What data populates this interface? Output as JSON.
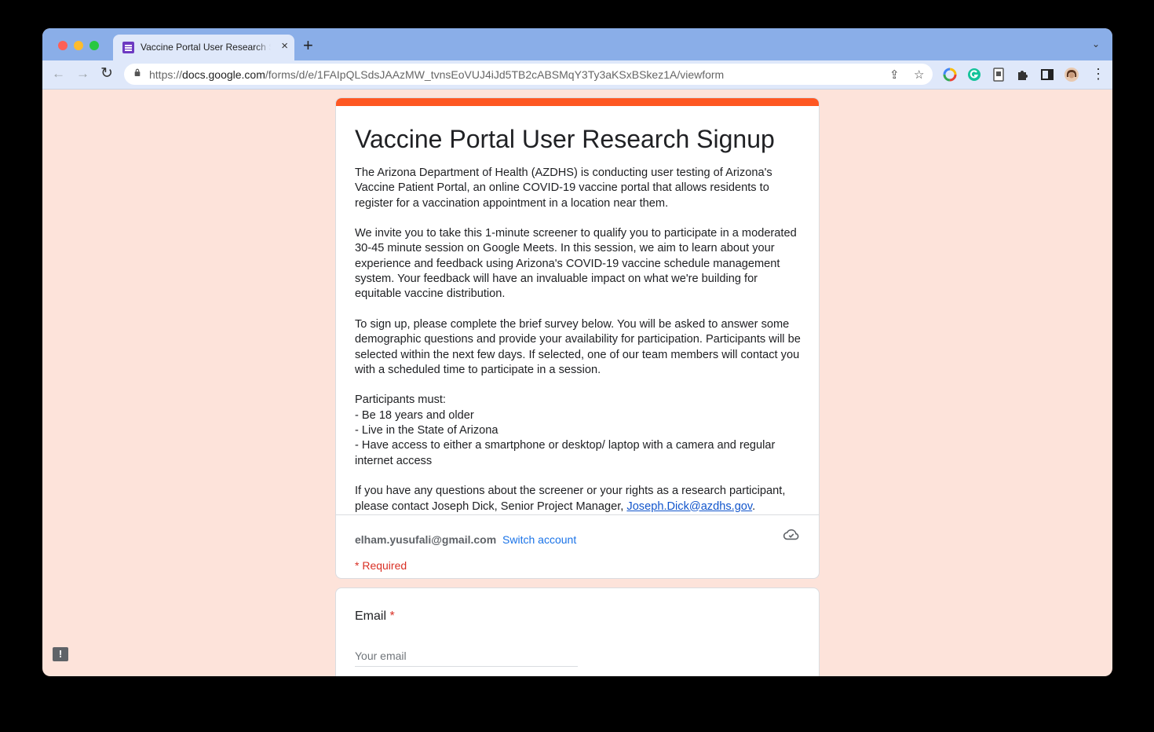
{
  "browser": {
    "tab_title": "Vaccine Portal User Research Signup",
    "url_prefix": "https://",
    "url_host": "docs.google.com",
    "url_path": "/forms/d/e/1FAIpQLSdsJAAzMW_tvnsEoVUJ4iJd5TB2cABSMqY3Ty3aKSxBSkez1A/viewform"
  },
  "icons": {
    "new_tab": "+",
    "tab_close": "×",
    "back": "←",
    "forward": "→",
    "reload": "↻",
    "share": "⇪",
    "star": "☆",
    "menu": "⋮",
    "tab_search": "⌄",
    "feedback": "!"
  },
  "form": {
    "title": "Vaccine Portal User Research Signup",
    "description": [
      "The Arizona Department of Health (AZDHS) is conducting user testing of Arizona's Vaccine Patient Portal, an online COVID-19 vaccine portal that allows residents to register for a vaccination appointment in a location near them.",
      "We invite you to take this 1-minute screener to qualify you to participate in a moderated 30-45 minute session on Google Meets. In this session, we aim to learn about your experience and feedback using Arizona's COVID-19 vaccine schedule management system. Your feedback will have an invaluable impact on what we're building for equitable vaccine distribution.",
      "To sign up, please complete the brief survey below. You will be asked to answer some demographic questions and provide your availability for participation. Participants will be selected within the next few days. If selected, one of our team members will contact you with a scheduled time to participate in a session."
    ],
    "requirements_title": "Participants must:",
    "requirements": [
      "- Be 18 years and older",
      "- Live in the State of Arizona",
      "- Have access to either a smartphone or desktop/ laptop with a camera and regular internet access"
    ],
    "contact_text": "If you have any questions about the screener or your rights as a research participant, please contact Joseph Dick, Senior Project Manager, ",
    "contact_email": "Joseph.Dick@azdhs.gov",
    "contact_end": ".",
    "account_email": "elham.yusufali@gmail.com",
    "switch_account": "Switch account",
    "required_note": "* Required"
  },
  "question": {
    "label": "Email",
    "required_mark": "*",
    "placeholder": "Your email"
  },
  "colors": {
    "accent": "#fe5722",
    "background": "#fde3da",
    "tabbar": "#8aaee8",
    "link": "#1155cc",
    "required": "#d93025"
  }
}
